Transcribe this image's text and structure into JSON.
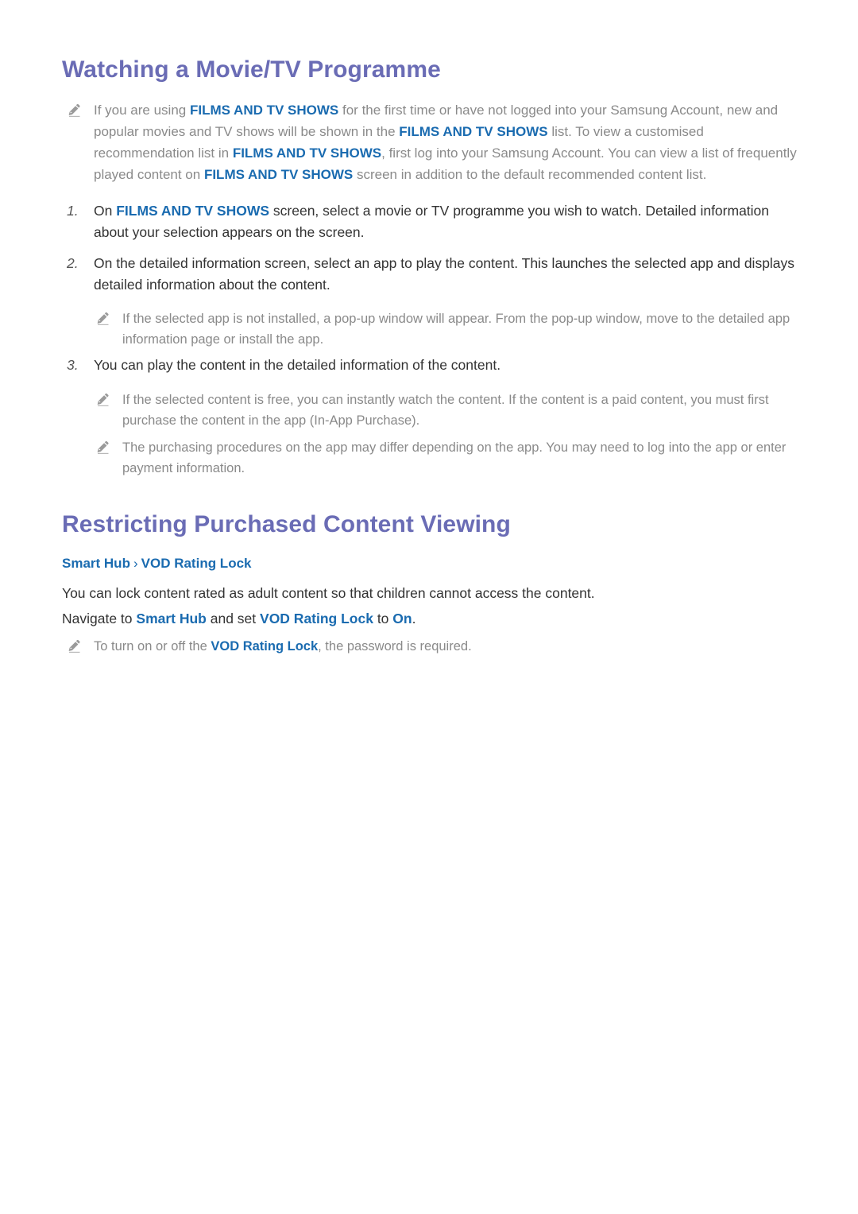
{
  "document": {
    "page_background": "#ffffff",
    "colors": {
      "heading": "#6a6cb5",
      "link_blue": "#1a6bb0",
      "body_text": "#333333",
      "note_text": "#8a8a8a",
      "step_number": "#555555"
    }
  },
  "sections": [
    {
      "title": "Watching a Movie/TV Programme",
      "intro_note": {
        "icon": "pencil-note-icon",
        "text_html": "If you are using <b>FILMS AND TV SHOWS</b> for the first time or have not logged into your Samsung Account, new and popular movies and TV shows will be shown in the <b>FILMS AND TV SHOWS</b> list. To view a customised recommendation list in <b>FILMS AND TV SHOWS</b>, first log into your Samsung Account. You can view a list of frequently played content on <b>FILMS AND TV SHOWS</b> screen in addition to the default recommended content list."
      },
      "steps": [
        {
          "number": "1.",
          "text_html": "On <b>FILMS AND TV SHOWS</b> screen, select a movie or TV programme you wish to watch. Detailed information about your selection appears on the screen."
        },
        {
          "number": "2.",
          "text_html": "On the detailed information screen, select an app to play the content. This launches the selected app and displays detailed information about the content."
        },
        {
          "number": "3.",
          "text_html": "You can play the content in the detailed information of the content."
        }
      ],
      "notes": [
        {
          "icon": "pencil-note-icon",
          "after_step": "2",
          "text_html": "If the selected app is not installed, a pop-up window will appear. From the pop-up window, move to the detailed app information page or install the app."
        },
        {
          "icon": "pencil-note-icon",
          "after_step": "3",
          "text_html": "If the selected content is free, you can instantly watch the content. If the content is a paid content, you must first purchase the content in the app (In-App Purchase)."
        },
        {
          "icon": "pencil-note-icon",
          "after_step": "3",
          "text_html": "The purchasing procedures on the app may differ depending on the app. You may need to log into the app or enter payment information."
        }
      ]
    },
    {
      "title": "Restricting Purchased Content Viewing",
      "breadcrumb": {
        "items": [
          "Smart Hub",
          "VOD Rating Lock"
        ],
        "separator": "›"
      },
      "paragraphs": [
        {
          "text_html": "You can lock content rated as adult content so that children cannot access the content."
        },
        {
          "text_html": "Navigate to <b>Smart Hub</b> and set <b>VOD Rating Lock</b> to <b>On</b>."
        }
      ],
      "notes": [
        {
          "icon": "pencil-note-icon",
          "text_html": "To turn on or off the <b>VOD Rating Lock</b>, the password is required."
        }
      ]
    }
  ]
}
